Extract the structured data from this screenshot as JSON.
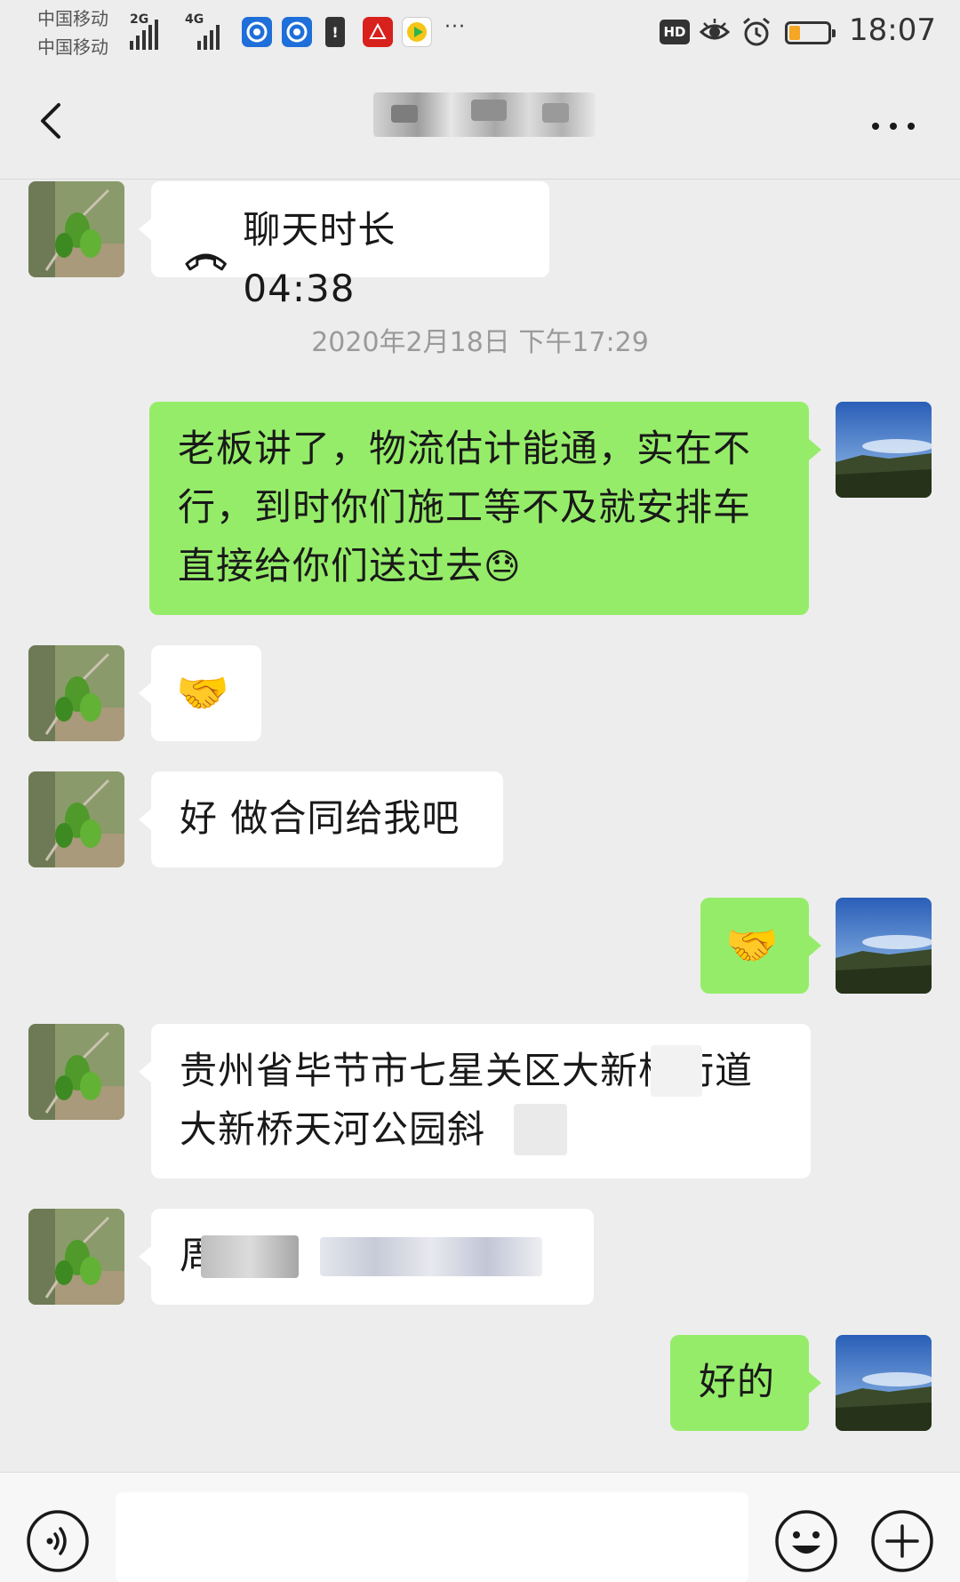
{
  "status_bar": {
    "carrier_1": "中国移动",
    "carrier_2": "中国移动",
    "network_1": "2G",
    "network_2": "4G",
    "hd_label": "HD",
    "time": "18:07",
    "more": "···",
    "battery_level": 0.25,
    "apps": [
      "blue-circle-app-icon",
      "blue-circle-app-icon",
      "sim-alert-icon",
      "xuexi-app-icon",
      "video-app-icon"
    ]
  },
  "header": {
    "title": "",
    "back_icon": "chevron-left-icon",
    "more_icon": "more-dots-icon"
  },
  "messages": {
    "call": {
      "label": "聊天时长 04:38",
      "icon": "phone-hangup-icon"
    },
    "timestamp": "2020年2月18日 下午17:29",
    "m1": "老板讲了，物流估计能通，实在不行，到时你们施工等不及就安排车直接给你们送过去",
    "m1_emoji": "😓",
    "m2_emoji": "🤝",
    "m3": "好 做合同给我吧",
    "m4_emoji": "🤝",
    "m5": "贵州省毕节市七星关区大新桥街道大新桥天河公园斜",
    "m6": "周",
    "m7": "好的"
  },
  "input_bar": {
    "voice_icon": "voice-icon",
    "emoji_icon": "emoji-icon",
    "plus_icon": "plus-icon",
    "placeholder": ""
  },
  "colors": {
    "background": "#ededed",
    "bubble_self": "#95ec69",
    "bubble_other": "#ffffff",
    "timestamp": "#9a9a9a"
  }
}
